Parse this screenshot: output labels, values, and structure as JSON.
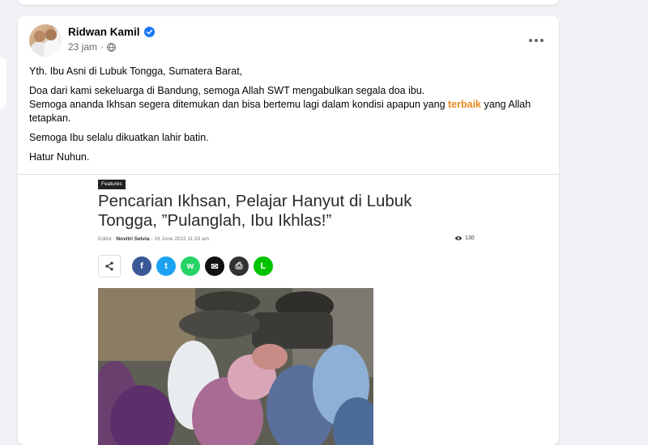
{
  "post": {
    "author": "Ridwan Kamil",
    "time": "23 jam",
    "time_separator": "·",
    "body": {
      "line1": "Yth. Ibu Asni di Lubuk Tongga, Sumatera Barat,",
      "line2": "Doa dari kami sekeluarga di Bandung, semoga Allah SWT mengabulkan segala doa ibu.",
      "line3_before": "Semoga ananda Ikhsan segera ditemukan dan bisa bertemu lagi dalam kondisi apapun yang ",
      "line3_highlight": "terbaik",
      "line3_after": " yang Allah tetapkan.",
      "line4": "Semoga Ibu selalu dikuatkan lahir batin.",
      "line5": "Hatur Nuhun."
    },
    "colors": {
      "highlight": "#e8891e",
      "verified": "#1877f2"
    }
  },
  "article": {
    "tag": "Features",
    "title": "Pencarian Ikhsan, Pelajar Hanyut di Lubuk Tongga, ”Pulanglah, Ibu Ikhlas!”",
    "editor_label": "Editor :",
    "editor_name": "Novitri Selvia",
    "date": "- 16 June 2022 11:33 am",
    "views": "130",
    "share_buttons": [
      {
        "name": "facebook",
        "glyph": "f",
        "color": "#3b5998"
      },
      {
        "name": "twitter",
        "glyph": "t",
        "color": "#1da1f2"
      },
      {
        "name": "whatsapp",
        "glyph": "w",
        "color": "#25d366"
      },
      {
        "name": "email",
        "glyph": "✉",
        "color": "#111111"
      },
      {
        "name": "print",
        "glyph": "⎙",
        "color": "#333333"
      },
      {
        "name": "line",
        "glyph": "L",
        "color": "#00c300"
      }
    ],
    "icons": [
      "share-icon",
      "eye-icon",
      "globe-icon",
      "verified-badge-icon",
      "more-options-icon"
    ]
  }
}
